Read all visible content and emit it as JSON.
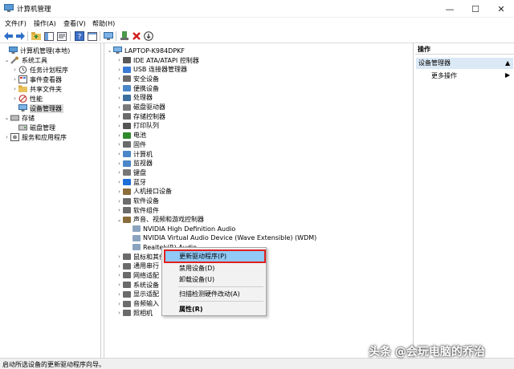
{
  "window": {
    "title": "计算机管理"
  },
  "menu": [
    "文件(F)",
    "操作(A)",
    "查看(V)",
    "帮助(H)"
  ],
  "tree": {
    "root": "计算机管理(本地)",
    "system_tools": "系统工具",
    "task_scheduler": "任务计划程序",
    "event_viewer": "事件查看器",
    "shared_folders": "共享文件夹",
    "performance": "性能",
    "device_manager": "设备管理器",
    "storage": "存储",
    "disk_management": "磁盘管理",
    "services": "服务和应用程序"
  },
  "devices": {
    "computer_name": "LAPTOP-K984DPKF",
    "categories": [
      "IDE ATA/ATAPI 控制器",
      "USB 连接器管理器",
      "安全设备",
      "便携设备",
      "处理器",
      "磁盘驱动器",
      "存储控制器",
      "打印队列",
      "电池",
      "固件",
      "计算机",
      "监视器",
      "键盘",
      "蓝牙",
      "人机接口设备",
      "软件设备",
      "软件组件",
      "声音、视频和游戏控制器"
    ],
    "audio_children": [
      "NVIDIA High Definition Audio",
      "NVIDIA Virtual Audio Device (Wave Extensible) (WDM)",
      "Realtek(R) Audio"
    ],
    "after": [
      "鼠标和其他",
      "通用串行",
      "网络适配",
      "系统设备",
      "显示适配",
      "音频输入",
      "照相机"
    ]
  },
  "context_menu": {
    "update_driver": "更新驱动程序(P)",
    "disable": "禁用设备(D)",
    "uninstall": "卸载设备(U)",
    "scan": "扫描检测硬件改动(A)",
    "properties": "属性(R)"
  },
  "actions": {
    "header": "操作",
    "title": "设备管理器",
    "more": "更多操作"
  },
  "status": {
    "text": "启动所选设备的更新驱动程序向导。"
  },
  "watermark": "头条 @会玩电脑的乔治",
  "colors": {
    "highlight": "#91c9f7",
    "border_red": "#e02020",
    "selected": "#d9d9d9"
  }
}
